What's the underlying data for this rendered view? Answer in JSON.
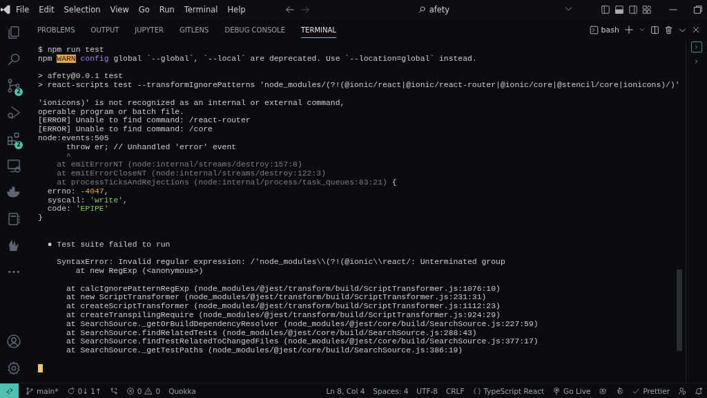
{
  "title_bar": {
    "menu": [
      "File",
      "Edit",
      "Selection",
      "View",
      "Go",
      "Run",
      "Terminal",
      "Help"
    ],
    "search": {
      "value": "afety"
    }
  },
  "activity_bar": {
    "items": [
      {
        "kind": "files",
        "active": false
      },
      {
        "kind": "search",
        "active": false
      },
      {
        "kind": "source-control",
        "active": false,
        "badge": "2"
      },
      {
        "kind": "run-debug",
        "active": false
      },
      {
        "kind": "extensions",
        "active": false,
        "badge": "2"
      },
      {
        "kind": "remote",
        "active": false
      },
      {
        "kind": "docker",
        "active": false
      },
      {
        "kind": "notebook",
        "active": false
      },
      {
        "kind": "leaf",
        "active": false
      },
      {
        "kind": "more",
        "active": false
      }
    ],
    "bottom": [
      {
        "kind": "account"
      },
      {
        "kind": "settings"
      }
    ]
  },
  "panel": {
    "tabs": [
      {
        "label": "PROBLEMS",
        "selected": false
      },
      {
        "label": "OUTPUT",
        "selected": false
      },
      {
        "label": "JUPYTER",
        "selected": false
      },
      {
        "label": "GITLENS",
        "selected": false
      },
      {
        "label": "DEBUG CONSOLE",
        "selected": false
      },
      {
        "label": "TERMINAL",
        "selected": true
      }
    ],
    "terminal_name": "bash",
    "terminals": [
      {
        "selected": true
      },
      {
        "selected": false
      }
    ],
    "lines": [
      {
        "kind": "text",
        "segments": [
          {
            "text": "$ npm run test",
            "kind": "plain"
          }
        ]
      },
      {
        "kind": "text",
        "segments": [
          {
            "text": "npm ",
            "kind": "plain"
          },
          {
            "text": "WARN",
            "kind": "warn"
          },
          {
            "text": " config",
            "kind": "keyword"
          },
          {
            "text": " global `--global`, `--local` are deprecated. Use `--location=global` instead.",
            "kind": "plain"
          }
        ]
      },
      {
        "kind": "blank"
      },
      {
        "kind": "text",
        "segments": [
          {
            "text": "> afety@0.0.1 test",
            "kind": "plain"
          }
        ]
      },
      {
        "kind": "text",
        "segments": [
          {
            "text": "> react-scripts test --transformIgnorePatterns 'node_modules/(?!(@ionic/react|@ionic/react-router|@ionic/core|@stencil/core|ionicons)/)'",
            "kind": "plain"
          }
        ]
      },
      {
        "kind": "blank"
      },
      {
        "kind": "text",
        "segments": [
          {
            "text": "'ionicons)' is not recognized as an internal or external command,",
            "kind": "plain"
          }
        ]
      },
      {
        "kind": "text",
        "segments": [
          {
            "text": "operable program or batch file.",
            "kind": "plain"
          }
        ]
      },
      {
        "kind": "text",
        "segments": [
          {
            "text": "[ERROR] Unable to find command: /react-router",
            "kind": "plain"
          }
        ]
      },
      {
        "kind": "text",
        "segments": [
          {
            "text": "[ERROR] Unable to find command: /core",
            "kind": "plain"
          }
        ]
      },
      {
        "kind": "text",
        "segments": [
          {
            "text": "node:events:505",
            "kind": "plain"
          }
        ]
      },
      {
        "kind": "text",
        "segments": [
          {
            "text": "      throw er; // Unhandled 'error' event",
            "kind": "plain"
          }
        ]
      },
      {
        "kind": "text",
        "segments": [
          {
            "text": "      ^",
            "kind": "dim"
          }
        ]
      },
      {
        "kind": "text",
        "segments": [
          {
            "text": "    at emitErrorNT (node:internal/streams/destroy:157:8)",
            "kind": "dim"
          }
        ]
      },
      {
        "kind": "text",
        "segments": [
          {
            "text": "    at emitErrorCloseNT (node:internal/streams/destroy:122:3)",
            "kind": "dim"
          }
        ]
      },
      {
        "kind": "text",
        "segments": [
          {
            "text": "    at processTicksAndRejections (node:internal/process/task_queues:83:21)",
            "kind": "dim"
          },
          {
            "text": " {",
            "kind": "plain"
          }
        ]
      },
      {
        "kind": "text",
        "segments": [
          {
            "text": "  errno: ",
            "kind": "plain"
          },
          {
            "text": "-4047",
            "kind": "number"
          },
          {
            "text": ",",
            "kind": "plain"
          }
        ]
      },
      {
        "kind": "text",
        "segments": [
          {
            "text": "  syscall: ",
            "kind": "plain"
          },
          {
            "text": "'write'",
            "kind": "string"
          },
          {
            "text": ",",
            "kind": "plain"
          }
        ]
      },
      {
        "kind": "text",
        "segments": [
          {
            "text": "  code: ",
            "kind": "plain"
          },
          {
            "text": "'EPIPE'",
            "kind": "string"
          }
        ]
      },
      {
        "kind": "text",
        "segments": [
          {
            "text": "}",
            "kind": "plain"
          }
        ]
      },
      {
        "kind": "blank"
      },
      {
        "kind": "blank"
      },
      {
        "kind": "text",
        "segments": [
          {
            "text": "  ● Test suite failed to run",
            "kind": "plain"
          }
        ]
      },
      {
        "kind": "blank"
      },
      {
        "kind": "text",
        "segments": [
          {
            "text": "    SyntaxError: Invalid regular expression: /'node_modules\\\\(?!(@ionic\\\\react/: Unterminated group",
            "kind": "plain"
          }
        ]
      },
      {
        "kind": "text",
        "segments": [
          {
            "text": "        at new RegExp (<anonymous>)",
            "kind": "plain"
          }
        ]
      },
      {
        "kind": "blank"
      },
      {
        "kind": "text",
        "segments": [
          {
            "text": "      at calcIgnorePatternRegExp (node_modules/@jest/transform/build/ScriptTransformer.js:1076:10)",
            "kind": "plain"
          }
        ]
      },
      {
        "kind": "text",
        "segments": [
          {
            "text": "      at new ScriptTransformer (node_modules/@jest/transform/build/ScriptTransformer.js:231:31)",
            "kind": "plain"
          }
        ]
      },
      {
        "kind": "text",
        "segments": [
          {
            "text": "      at createScriptTransformer (node_modules/@jest/transform/build/ScriptTransformer.js:1112:23)",
            "kind": "plain"
          }
        ]
      },
      {
        "kind": "text",
        "segments": [
          {
            "text": "      at createTranspilingRequire (node_modules/@jest/transform/build/ScriptTransformer.js:924:29)",
            "kind": "plain"
          }
        ]
      },
      {
        "kind": "text",
        "segments": [
          {
            "text": "      at SearchSource._getOrBuildDependencyResolver (node_modules/@jest/core/build/SearchSource.js:227:59)",
            "kind": "plain"
          }
        ]
      },
      {
        "kind": "text",
        "segments": [
          {
            "text": "      at SearchSource.findRelatedTests (node_modules/@jest/core/build/SearchSource.js:288:43)",
            "kind": "plain"
          }
        ]
      },
      {
        "kind": "text",
        "segments": [
          {
            "text": "      at SearchSource.findTestRelatedToChangedFiles (node_modules/@jest/core/build/SearchSource.js:377:17)",
            "kind": "plain"
          }
        ]
      },
      {
        "kind": "text",
        "segments": [
          {
            "text": "      at SearchSource._getTestPaths (node_modules/@jest/core/build/SearchSource.js:386:19)",
            "kind": "plain"
          }
        ]
      },
      {
        "kind": "blank"
      },
      {
        "kind": "cursor"
      }
    ]
  },
  "status_bar": {
    "left": [
      {
        "kind": "remote"
      },
      {
        "kind": "branch",
        "text": "main*"
      },
      {
        "kind": "sync",
        "text": "0↓ 1↑"
      },
      {
        "kind": "graph"
      },
      {
        "kind": "problems",
        "errors": "0",
        "warnings": "0"
      },
      {
        "kind": "text",
        "text": "Quokka"
      }
    ],
    "right": [
      {
        "kind": "text",
        "text": "Ln 8, Col 4"
      },
      {
        "kind": "text",
        "text": "Spaces: 4"
      },
      {
        "kind": "text",
        "text": "UTF-8"
      },
      {
        "kind": "text",
        "text": "CRLF"
      },
      {
        "kind": "language",
        "text": "TypeScript React"
      },
      {
        "kind": "live",
        "text": "Go Live"
      },
      {
        "kind": "copilot"
      },
      {
        "kind": "gear"
      },
      {
        "kind": "check",
        "text": "Prettier"
      },
      {
        "kind": "feedback"
      },
      {
        "kind": "bell"
      }
    ]
  }
}
